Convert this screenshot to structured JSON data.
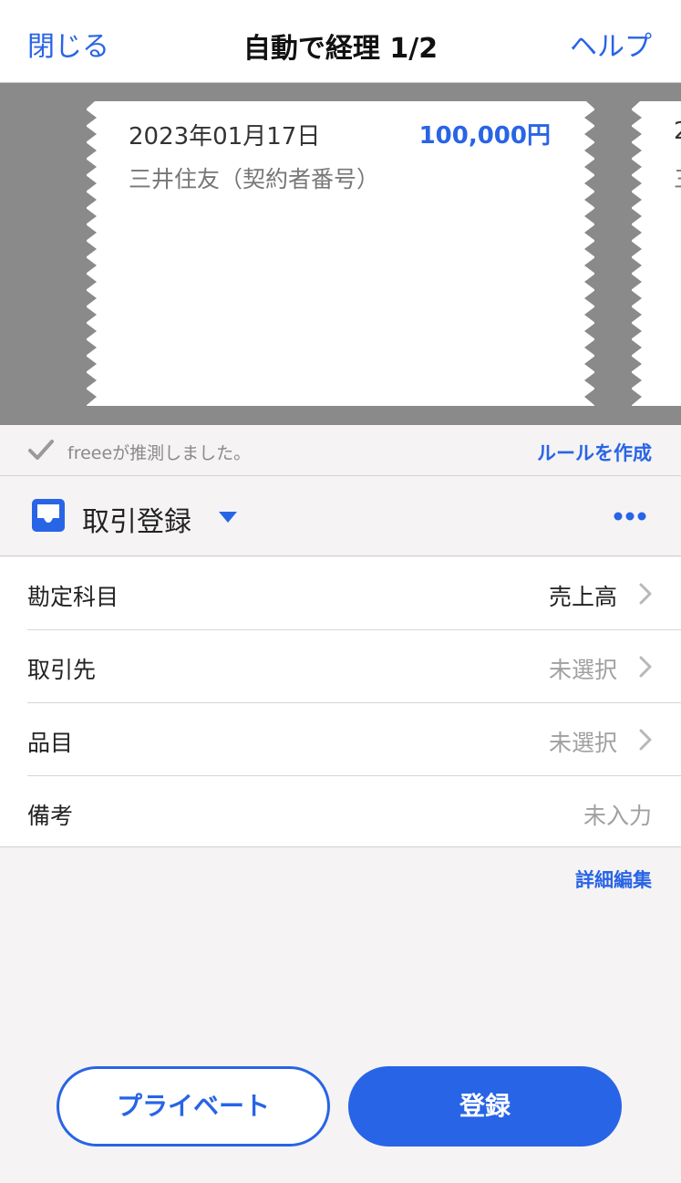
{
  "nav": {
    "close_label": "閉じる",
    "title": "自動で経理 1/2",
    "help_label": "ヘルプ"
  },
  "receipt": {
    "date": "2023年01月17日",
    "amount": "100,000円",
    "description": "三井住友（契約者番号）"
  },
  "receipt_next": {
    "date_partial": "2",
    "desc_partial": "三"
  },
  "guess": {
    "text": "freeeが推測しました。",
    "rule_link": "ルールを作成"
  },
  "section": {
    "title": "取引登録",
    "icon": "inbox-icon"
  },
  "form": {
    "rows": [
      {
        "label": "勘定科目",
        "value": "売上高",
        "muted": false,
        "chevron": true
      },
      {
        "label": "取引先",
        "value": "未選択",
        "muted": true,
        "chevron": true
      },
      {
        "label": "品目",
        "value": "未選択",
        "muted": true,
        "chevron": true
      },
      {
        "label": "備考",
        "value": "未入力",
        "muted": true,
        "chevron": false
      }
    ]
  },
  "detail_link": "詳細編集",
  "buttons": {
    "private_label": "プライベート",
    "register_label": "登録"
  },
  "colors": {
    "accent": "#2864e6",
    "receipt_bg": "#8a8a8a",
    "page_bg": "#f5f3f4"
  }
}
